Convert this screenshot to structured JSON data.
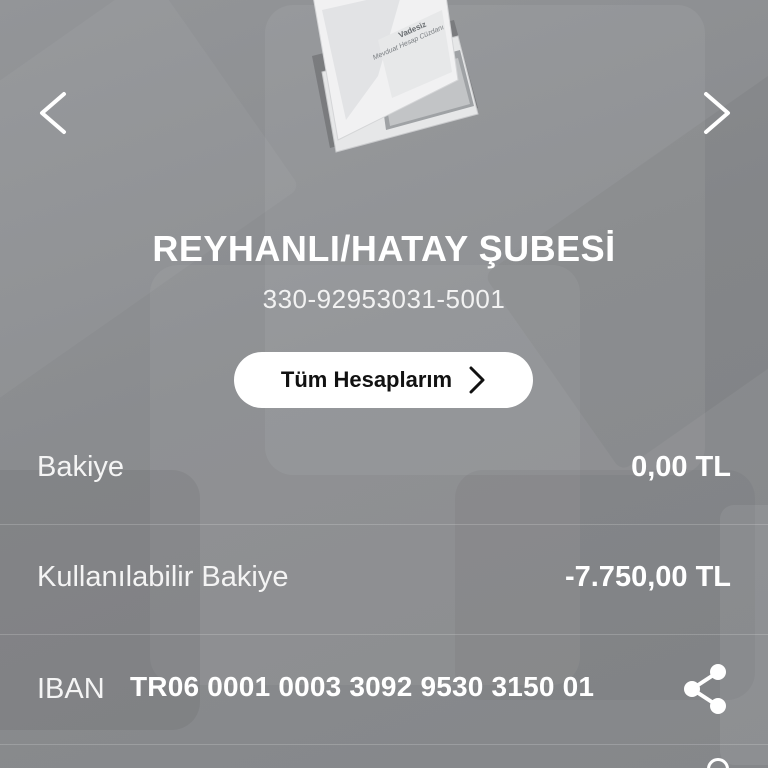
{
  "account": {
    "branch_name": "REYHANLI/HATAY ŞUBESİ",
    "account_number": "330-92953031-5001"
  },
  "passbook": {
    "title": "Vadesiz",
    "subtitle": "Mevduat Hesap Cüzdanı"
  },
  "actions": {
    "all_accounts_label": "Tüm Hesaplarım"
  },
  "rows": {
    "balance": {
      "label": "Bakiye",
      "value": "0,00 TL"
    },
    "available_balance": {
      "label": "Kullanılabilir Bakiye",
      "value": "-7.750,00 TL"
    },
    "iban": {
      "label": "IBAN",
      "value": "TR06 0001 0003 3092 9530 3150 01"
    }
  },
  "icons": {
    "prev": "chevron-left-icon",
    "next": "chevron-right-icon",
    "button_chevron": "chevron-right-icon",
    "share": "share-icon"
  },
  "colors": {
    "background": "#8c8e91",
    "text": "#ffffff",
    "button_bg": "#ffffff",
    "button_text": "#111111"
  }
}
